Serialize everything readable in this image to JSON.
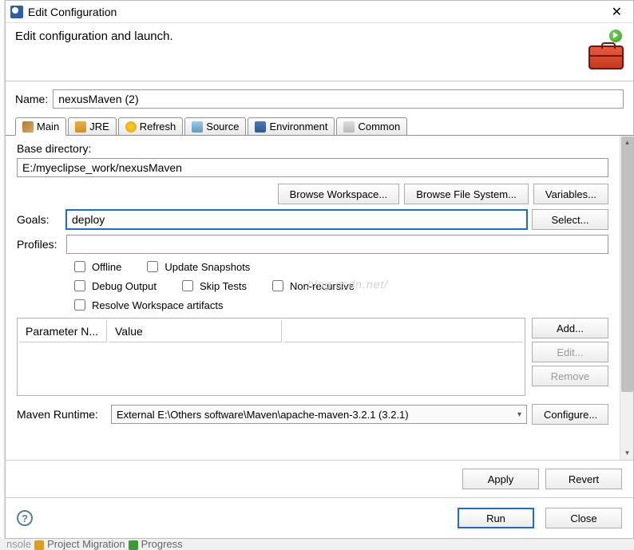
{
  "title": "Edit Configuration",
  "subtitle": "Edit configuration and launch.",
  "name_label": "Name:",
  "name_value": "nexusMaven (2)",
  "tabs": {
    "main": "Main",
    "jre": "JRE",
    "refresh": "Refresh",
    "source": "Source",
    "environment": "Environment",
    "common": "Common"
  },
  "base_dir_label": "Base directory:",
  "base_dir_value": "E:/myeclipse_work/nexusMaven",
  "buttons": {
    "browse_workspace": "Browse Workspace...",
    "browse_fs": "Browse File System...",
    "variables": "Variables...",
    "select": "Select...",
    "add": "Add...",
    "edit": "Edit...",
    "remove": "Remove",
    "configure": "Configure...",
    "apply": "Apply",
    "revert": "Revert",
    "run": "Run",
    "close": "Close"
  },
  "goals_label": "Goals:",
  "goals_value": "deploy",
  "profiles_label": "Profiles:",
  "profiles_value": "",
  "chk": {
    "offline": "Offline",
    "update": "Update Snapshots",
    "debug": "Debug Output",
    "skip": "Skip Tests",
    "nonrec": "Non-recursive",
    "resolve": "Resolve Workspace artifacts"
  },
  "table": {
    "col1": "Parameter N...",
    "col2": "Value"
  },
  "runtime_label": "Maven Runtime:",
  "runtime_value": "External E:\\Others software\\Maven\\apache-maven-3.2.1 (3.2.1)",
  "watermark": "blog.csdn.net/",
  "bg": {
    "t1": "Project Migration",
    "t2": "Progress"
  }
}
